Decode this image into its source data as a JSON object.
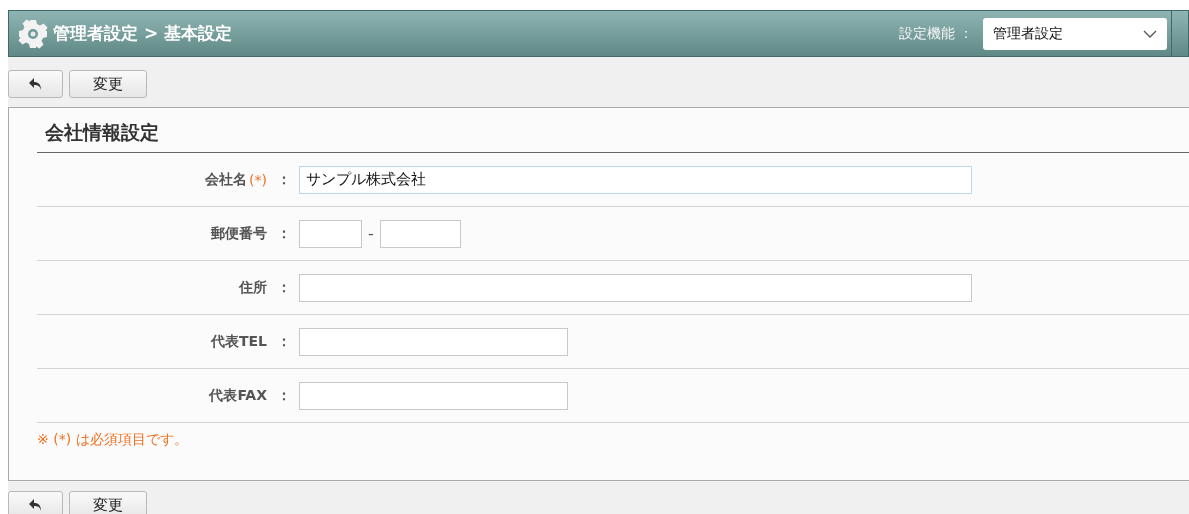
{
  "header": {
    "title": "管理者設定 > 基本設定",
    "function_label": "設定機能 ：",
    "function_select": "管理者設定"
  },
  "toolbar": {
    "buttons": [
      {
        "kind": "back"
      },
      {
        "kind": "text",
        "label": "変更"
      }
    ]
  },
  "section": {
    "title": "会社情報設定",
    "fields": [
      {
        "label": "会社名",
        "required_mark": "(*)",
        "colon": "：",
        "kind": "wide",
        "value": "サンプル株式会社"
      },
      {
        "label": "郵便番号",
        "colon": "：",
        "kind": "postal",
        "separator": "-"
      },
      {
        "label": "住所",
        "colon": "：",
        "kind": "wide"
      },
      {
        "label": "代表TEL",
        "colon": "：",
        "kind": "medium"
      },
      {
        "label": "代表FAX",
        "colon": "：",
        "kind": "medium"
      }
    ],
    "note": "※ (*) は必須項目です。"
  },
  "bottom_toolbar": {
    "buttons": [
      {
        "kind": "back"
      },
      {
        "kind": "text",
        "label": "変更"
      }
    ]
  }
}
